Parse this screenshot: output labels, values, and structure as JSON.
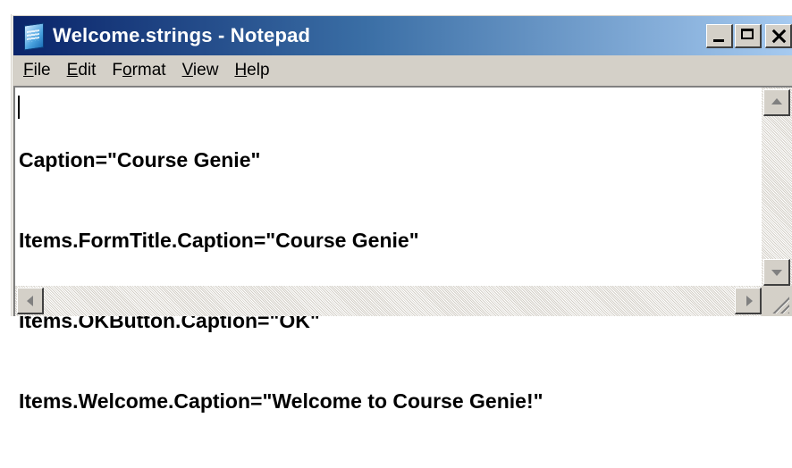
{
  "window": {
    "title": "Welcome.strings - Notepad",
    "icon": "notepad-icon"
  },
  "caption_buttons": {
    "minimize": "minimize-icon",
    "maximize": "maximize-icon",
    "close": "close-icon"
  },
  "menu": {
    "file": {
      "hotkey": "F",
      "rest": "ile"
    },
    "edit": {
      "hotkey": "E",
      "rest": "dit"
    },
    "format": {
      "pre": "F",
      "hotkey": "o",
      "rest": "rmat"
    },
    "view": {
      "hotkey": "V",
      "rest": "iew"
    },
    "help": {
      "hotkey": "H",
      "rest": "elp"
    }
  },
  "editor": {
    "lines": [
      "Caption=\"Course Genie\"",
      "Items.FormTitle.Caption=\"Course Genie\"",
      "Items.OKButton.Caption=\"OK\"",
      "Items.Welcome.Caption=\"Welcome to Course Genie!\""
    ]
  },
  "colors": {
    "titlebar_start": "#0a246a",
    "titlebar_end": "#a6caf0",
    "chrome": "#d4d0c8"
  }
}
